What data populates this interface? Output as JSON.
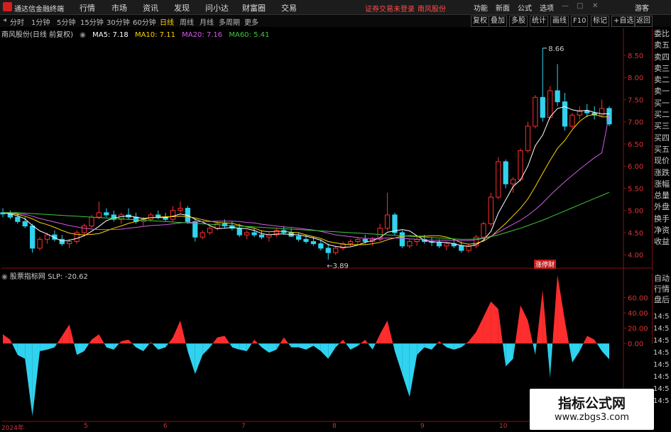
{
  "app": {
    "title": "通达信金融终端"
  },
  "menu": [
    "行情",
    "市场",
    "资讯",
    "发现",
    "问小达",
    "财富圈",
    "交易"
  ],
  "notice": {
    "status": "证券交易未登录",
    "stock": "南风股份"
  },
  "right_menu": [
    "功能",
    "新面",
    "公式",
    "选项"
  ],
  "guest": "游客",
  "periods": [
    {
      "label": "分时",
      "active": false
    },
    {
      "label": "1分钟",
      "active": false
    },
    {
      "label": "5分钟",
      "active": false
    },
    {
      "label": "15分钟",
      "active": false
    },
    {
      "label": "30分钟",
      "active": false
    },
    {
      "label": "60分钟",
      "active": false
    },
    {
      "label": "日线",
      "active": true
    },
    {
      "label": "周线",
      "active": false
    },
    {
      "label": "月线",
      "active": false
    },
    {
      "label": "多周期",
      "active": false
    },
    {
      "label": "更多",
      "active": false
    }
  ],
  "tools": [
    "复权",
    "叠加",
    "多股",
    "统计",
    "画线",
    "F10",
    "标记",
    "+自选",
    "返回"
  ],
  "legend": {
    "name": "南风股份(日线 前复权)",
    "ma5": "MA5: 7.18",
    "ma10": "MA10: 7.11",
    "ma20": "MA20: 7.16",
    "ma60": "MA60: 5.41"
  },
  "side_items": [
    "委比",
    "卖五",
    "卖四",
    "卖三",
    "卖二",
    "卖一",
    "买一",
    "买二",
    "买三",
    "买四",
    "买五",
    "现价",
    "涨跌",
    "涨幅",
    "总量",
    "外盘",
    "换手",
    "净资",
    "收益"
  ],
  "side_items2": [
    "自动",
    "行情",
    "盘后"
  ],
  "time_items": [
    "14:5",
    "14:5",
    "14:5",
    "14:5",
    "14:5",
    "14:5",
    "14:5",
    "14:5"
  ],
  "indicator": {
    "name": "股票指标网",
    "value": "SLP: -20.62"
  },
  "annotations": {
    "high": "8.66",
    "low": "3.89",
    "tag": "涨停财"
  },
  "x_labels": [
    "2024年",
    "5",
    "6",
    "7",
    "8",
    "9",
    "10"
  ],
  "watermark": {
    "title": "指标公式网",
    "url": "www.zbgs3.com"
  },
  "colors": {
    "up": "#ff2e2e",
    "down": "#2fd3f0",
    "ma5": "#ffffff",
    "ma10": "#ffd200",
    "ma20": "#d25ae6",
    "ma60": "#3ec83e",
    "axis": "#8a1010"
  },
  "chart_data": {
    "type": "candlestick",
    "price_axis": {
      "ticks": [
        8.5,
        8.0,
        7.5,
        7.0,
        6.5,
        6.0,
        5.5,
        5.0,
        4.5,
        4.0
      ],
      "ylim": [
        3.7,
        8.85
      ]
    },
    "indicator_axis": {
      "ticks": [
        60.0,
        40.0,
        20.0,
        0.0
      ],
      "ylim": [
        -100,
        80
      ]
    },
    "months": [
      "2024年",
      "5",
      "6",
      "7",
      "8",
      "9",
      "10"
    ],
    "ohlc": [
      [
        4.95,
        5.05,
        4.85,
        4.92
      ],
      [
        4.92,
        5.0,
        4.8,
        4.85
      ],
      [
        4.85,
        4.95,
        4.7,
        4.75
      ],
      [
        4.75,
        4.85,
        4.6,
        4.65
      ],
      [
        4.65,
        4.7,
        4.05,
        4.15
      ],
      [
        4.15,
        4.4,
        4.1,
        4.35
      ],
      [
        4.35,
        4.5,
        4.25,
        4.45
      ],
      [
        4.45,
        4.55,
        4.3,
        4.35
      ],
      [
        4.35,
        4.45,
        4.2,
        4.25
      ],
      [
        4.25,
        4.35,
        4.15,
        4.3
      ],
      [
        4.3,
        4.55,
        4.25,
        4.5
      ],
      [
        4.5,
        4.7,
        4.45,
        4.65
      ],
      [
        4.65,
        4.9,
        4.6,
        4.85
      ],
      [
        4.85,
        5.2,
        4.8,
        4.95
      ],
      [
        4.95,
        5.05,
        4.85,
        4.9
      ],
      [
        4.9,
        5.0,
        4.75,
        4.8
      ],
      [
        4.8,
        4.95,
        4.7,
        4.9
      ],
      [
        4.9,
        5.05,
        4.8,
        4.85
      ],
      [
        4.85,
        4.95,
        4.7,
        4.75
      ],
      [
        4.75,
        4.85,
        4.65,
        4.8
      ],
      [
        4.8,
        4.95,
        4.75,
        4.9
      ],
      [
        4.9,
        5.0,
        4.8,
        4.85
      ],
      [
        4.85,
        4.95,
        4.75,
        4.8
      ],
      [
        4.8,
        5.1,
        4.75,
        5.0
      ],
      [
        5.0,
        5.2,
        4.95,
        5.05
      ],
      [
        5.05,
        5.1,
        4.7,
        4.75
      ],
      [
        4.75,
        4.8,
        4.3,
        4.4
      ],
      [
        4.4,
        4.55,
        4.35,
        4.5
      ],
      [
        4.5,
        4.65,
        4.45,
        4.6
      ],
      [
        4.6,
        4.75,
        4.55,
        4.7
      ],
      [
        4.7,
        4.8,
        4.6,
        4.65
      ],
      [
        4.65,
        4.75,
        4.55,
        4.6
      ],
      [
        4.6,
        4.7,
        4.4,
        4.45
      ],
      [
        4.45,
        4.55,
        4.35,
        4.5
      ],
      [
        4.5,
        4.6,
        4.4,
        4.45
      ],
      [
        4.45,
        4.55,
        4.35,
        4.4
      ],
      [
        4.4,
        4.5,
        4.3,
        4.45
      ],
      [
        4.45,
        4.6,
        4.4,
        4.55
      ],
      [
        4.55,
        4.65,
        4.45,
        4.5
      ],
      [
        4.5,
        4.6,
        4.4,
        4.42
      ],
      [
        4.42,
        4.5,
        4.3,
        4.35
      ],
      [
        4.35,
        4.45,
        4.25,
        4.3
      ],
      [
        4.3,
        4.4,
        4.2,
        4.25
      ],
      [
        4.25,
        4.35,
        4.1,
        4.15
      ],
      [
        4.15,
        4.25,
        3.89,
        4.05
      ],
      [
        4.05,
        4.2,
        4.0,
        4.15
      ],
      [
        4.15,
        4.3,
        4.1,
        4.25
      ],
      [
        4.25,
        4.35,
        4.2,
        4.3
      ],
      [
        4.3,
        4.4,
        4.25,
        4.35
      ],
      [
        4.35,
        4.45,
        4.25,
        4.3
      ],
      [
        4.3,
        4.4,
        4.2,
        4.35
      ],
      [
        4.35,
        4.7,
        4.3,
        4.6
      ],
      [
        4.6,
        5.4,
        4.55,
        4.9
      ],
      [
        4.9,
        4.95,
        4.45,
        4.5
      ],
      [
        4.5,
        4.55,
        4.15,
        4.2
      ],
      [
        4.2,
        4.35,
        4.15,
        4.3
      ],
      [
        4.3,
        4.4,
        4.2,
        4.35
      ],
      [
        4.35,
        4.45,
        4.25,
        4.3
      ],
      [
        4.3,
        4.4,
        4.2,
        4.28
      ],
      [
        4.28,
        4.35,
        4.15,
        4.2
      ],
      [
        4.2,
        4.3,
        4.1,
        4.25
      ],
      [
        4.25,
        4.35,
        4.15,
        4.2
      ],
      [
        4.2,
        4.3,
        4.05,
        4.1
      ],
      [
        4.1,
        4.25,
        4.05,
        4.2
      ],
      [
        4.2,
        4.45,
        4.15,
        4.4
      ],
      [
        4.4,
        4.75,
        4.35,
        4.7
      ],
      [
        4.7,
        5.4,
        4.65,
        5.3
      ],
      [
        5.3,
        6.2,
        5.25,
        6.1
      ],
      [
        6.1,
        6.15,
        5.5,
        5.6
      ],
      [
        5.6,
        5.75,
        5.4,
        5.7
      ],
      [
        5.7,
        6.4,
        5.65,
        6.35
      ],
      [
        6.35,
        7.0,
        6.3,
        6.9
      ],
      [
        6.9,
        7.6,
        6.85,
        7.55
      ],
      [
        7.55,
        8.66,
        7.0,
        7.1
      ],
      [
        7.1,
        7.8,
        7.05,
        7.7
      ],
      [
        7.7,
        8.3,
        7.35,
        7.45
      ],
      [
        7.45,
        7.65,
        6.8,
        6.9
      ],
      [
        6.9,
        7.2,
        6.85,
        7.15
      ],
      [
        7.15,
        7.35,
        7.05,
        7.25
      ],
      [
        7.25,
        7.4,
        7.1,
        7.2
      ],
      [
        7.2,
        7.35,
        7.05,
        7.15
      ],
      [
        7.15,
        7.5,
        7.1,
        7.3
      ],
      [
        7.3,
        7.35,
        6.9,
        6.95
      ]
    ],
    "ma_series": [
      {
        "name": "MA5",
        "values": [
          4.95,
          4.92,
          4.88,
          4.81,
          4.66,
          4.54,
          4.47,
          4.39,
          4.31,
          4.33,
          4.37,
          4.43,
          4.53,
          4.64,
          4.77,
          4.83,
          4.86,
          4.88,
          4.85,
          4.82,
          4.84,
          4.84,
          4.84,
          4.87,
          4.92,
          4.89,
          4.8,
          4.74,
          4.66,
          4.59,
          4.6,
          4.62,
          4.6,
          4.59,
          4.55,
          4.48,
          4.45,
          4.47,
          4.47,
          4.46,
          4.45,
          4.42,
          4.38,
          4.33,
          4.23,
          4.19,
          4.17,
          4.18,
          4.22,
          4.28,
          4.32,
          4.39,
          4.51,
          4.54,
          4.57,
          4.54,
          4.43,
          4.33,
          4.29,
          4.29,
          4.28,
          4.25,
          4.21,
          4.19,
          4.23,
          4.33,
          4.53,
          4.94,
          5.24,
          5.54,
          5.69,
          6.0,
          6.46,
          6.7,
          7.11,
          7.3,
          7.34,
          7.27,
          7.24,
          7.26,
          7.21,
          7.18,
          7.18
        ]
      },
      {
        "name": "MA10",
        "values": [
          4.95,
          4.94,
          4.91,
          4.87,
          4.81,
          4.73,
          4.68,
          4.62,
          4.55,
          4.49,
          4.46,
          4.45,
          4.46,
          4.48,
          4.54,
          4.6,
          4.65,
          4.71,
          4.75,
          4.8,
          4.84,
          4.85,
          4.86,
          4.86,
          4.87,
          4.86,
          4.83,
          4.79,
          4.76,
          4.73,
          4.72,
          4.71,
          4.67,
          4.63,
          4.6,
          4.54,
          4.52,
          4.53,
          4.53,
          4.51,
          4.5,
          4.45,
          4.41,
          4.37,
          4.3,
          4.27,
          4.24,
          4.23,
          4.23,
          4.23,
          4.25,
          4.28,
          4.34,
          4.38,
          4.42,
          4.43,
          4.42,
          4.42,
          4.43,
          4.43,
          4.4,
          4.35,
          4.27,
          4.24,
          4.26,
          4.31,
          4.41,
          4.56,
          4.71,
          4.88,
          5.05,
          5.26,
          5.54,
          5.84,
          6.13,
          6.4,
          6.58,
          6.82,
          7.01,
          7.13,
          7.17,
          7.11,
          7.11
        ]
      },
      {
        "name": "MA20",
        "values": [
          4.95,
          4.95,
          4.93,
          4.91,
          4.87,
          4.82,
          4.78,
          4.74,
          4.7,
          4.66,
          4.63,
          4.6,
          4.58,
          4.57,
          4.57,
          4.57,
          4.58,
          4.6,
          4.62,
          4.64,
          4.66,
          4.67,
          4.68,
          4.7,
          4.72,
          4.73,
          4.74,
          4.75,
          4.75,
          4.76,
          4.76,
          4.76,
          4.75,
          4.73,
          4.72,
          4.69,
          4.67,
          4.65,
          4.63,
          4.62,
          4.6,
          4.58,
          4.56,
          4.53,
          4.49,
          4.45,
          4.43,
          4.41,
          4.39,
          4.37,
          4.37,
          4.37,
          4.38,
          4.38,
          4.37,
          4.36,
          4.35,
          4.34,
          4.33,
          4.33,
          4.33,
          4.33,
          4.32,
          4.32,
          4.34,
          4.37,
          4.42,
          4.51,
          4.6,
          4.69,
          4.78,
          4.89,
          5.02,
          5.17,
          5.34,
          5.5,
          5.65,
          5.79,
          5.93,
          6.06,
          6.19,
          6.3,
          7.16
        ]
      },
      {
        "name": "MA60",
        "values": [
          4.95,
          4.95,
          4.95,
          4.94,
          4.93,
          4.92,
          4.91,
          4.9,
          4.89,
          4.88,
          4.87,
          4.86,
          4.85,
          4.84,
          4.83,
          4.82,
          4.81,
          4.8,
          4.79,
          4.78,
          4.77,
          4.76,
          4.75,
          4.74,
          4.73,
          4.72,
          4.71,
          4.7,
          4.69,
          4.68,
          4.67,
          4.66,
          4.65,
          4.64,
          4.63,
          4.62,
          4.61,
          4.6,
          4.59,
          4.58,
          4.57,
          4.56,
          4.55,
          4.54,
          4.53,
          4.52,
          4.51,
          4.5,
          4.49,
          4.48,
          4.47,
          4.46,
          4.45,
          4.44,
          4.43,
          4.42,
          4.41,
          4.4,
          4.39,
          4.38,
          4.37,
          4.36,
          4.35,
          4.35,
          4.36,
          4.38,
          4.41,
          4.45,
          4.5,
          4.55,
          4.6,
          4.66,
          4.72,
          4.78,
          4.85,
          4.92,
          4.99,
          5.06,
          5.13,
          5.2,
          5.27,
          5.34,
          5.41
        ]
      }
    ],
    "slp": [
      12,
      5,
      -15,
      -20,
      -95,
      -10,
      -8,
      -5,
      10,
      25,
      -15,
      -10,
      5,
      12,
      -5,
      -8,
      3,
      5,
      -5,
      -10,
      2,
      -8,
      -5,
      8,
      30,
      -10,
      -40,
      -15,
      -5,
      8,
      10,
      -5,
      -8,
      -10,
      5,
      -5,
      -12,
      -8,
      8,
      -5,
      -5,
      -8,
      -3,
      -10,
      -20,
      -5,
      5,
      -8,
      -3,
      5,
      -8,
      12,
      30,
      -10,
      -40,
      -70,
      -15,
      -5,
      -8,
      3,
      -5,
      -8,
      -5,
      3,
      15,
      35,
      55,
      45,
      -30,
      -20,
      50,
      30,
      -15,
      70,
      -45,
      90,
      30,
      -25,
      -10,
      10,
      5,
      -10,
      -20.62
    ]
  }
}
